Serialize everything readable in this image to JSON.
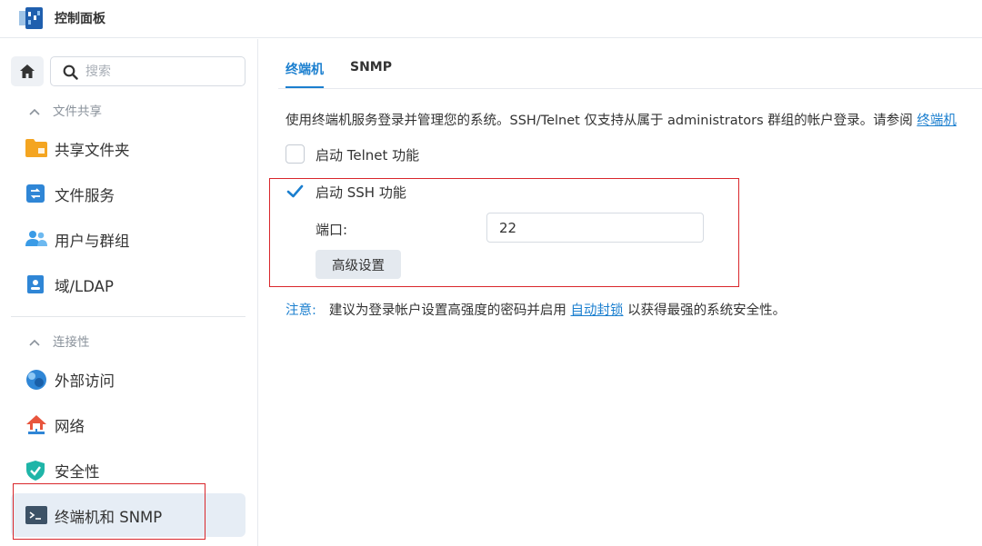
{
  "app": {
    "title": "控制面板"
  },
  "sidebar": {
    "search_placeholder": "搜索",
    "sections": [
      {
        "label": "文件共享"
      },
      {
        "label": "连接性"
      }
    ],
    "items": [
      {
        "label": "共享文件夹",
        "icon": "folder-icon"
      },
      {
        "label": "文件服务",
        "icon": "file-services-icon"
      },
      {
        "label": "用户与群组",
        "icon": "users-icon"
      },
      {
        "label": "域/LDAP",
        "icon": "domain-icon"
      },
      {
        "label": "外部访问",
        "icon": "external-access-icon"
      },
      {
        "label": "网络",
        "icon": "network-icon"
      },
      {
        "label": "安全性",
        "icon": "shield-icon"
      },
      {
        "label": "终端机和 SNMP",
        "icon": "terminal-icon",
        "active": true
      }
    ]
  },
  "tabs": [
    {
      "label": "终端机",
      "active": true
    },
    {
      "label": "SNMP",
      "active": false
    }
  ],
  "main": {
    "description": "使用终端机服务登录并管理您的系统。SSH/Telnet 仅支持从属于 administrators 群组的帐户登录。请参阅 ",
    "description_link": "终端机",
    "telnet_label": "启动 Telnet 功能",
    "telnet_checked": false,
    "ssh_label": "启动 SSH 功能",
    "ssh_checked": true,
    "port_label": "端口:",
    "port_value": "22",
    "advanced_button": "高级设置",
    "note_key": "注意:",
    "note_text": "建议为登录帐户设置高强度的密码并启用 ",
    "note_link": "自动封锁",
    "note_tail": " 以获得最强的系统安全性。"
  },
  "colors": {
    "accent": "#1b7fcf",
    "highlight_box": "#d9262b",
    "active_item_bg": "#e6edf5"
  }
}
